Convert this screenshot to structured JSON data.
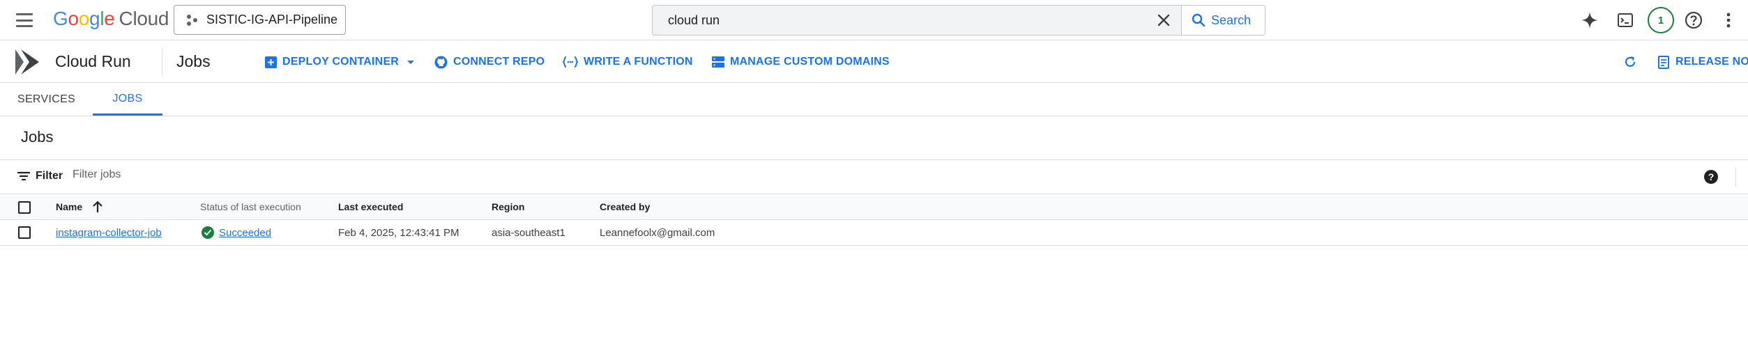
{
  "topbar": {
    "logo_google": [
      "G",
      "o",
      "o",
      "g",
      "l",
      "e"
    ],
    "logo_cloud": "Cloud",
    "project_name": "SISTIC-IG-API-Pipeline",
    "search_value": "cloud run",
    "search_button_label": "Search",
    "notification_count": "1"
  },
  "product": {
    "title": "Cloud Run",
    "page_heading": "Jobs",
    "actions": {
      "deploy_container": "DEPLOY CONTAINER",
      "connect_repo": "CONNECT REPO",
      "write_function": "WRITE A FUNCTION",
      "manage_domains": "MANAGE CUSTOM DOMAINS",
      "release_notes": "RELEASE NOTES"
    }
  },
  "tabs": [
    {
      "label": "SERVICES",
      "active": false
    },
    {
      "label": "JOBS",
      "active": true
    }
  ],
  "section": {
    "title": "Jobs",
    "filter_label": "Filter",
    "filter_placeholder": "Filter jobs",
    "help": "?"
  },
  "table": {
    "columns": [
      "Name",
      "Status of last execution",
      "Last executed",
      "Region",
      "Created by"
    ],
    "sort_column": "Name",
    "sort_direction": "ascending",
    "rows": [
      {
        "name": "instagram-collector-job",
        "status": "Succeeded",
        "last_executed": "Feb 4, 2025, 12:43:41 PM",
        "region": "asia-southeast1",
        "created_by": "Leannefoolx@gmail.com"
      }
    ]
  },
  "colors": {
    "accent": "#1a73e8",
    "success": "#188038",
    "border": "#dadce0",
    "text": "#202124"
  },
  "icons": {
    "menu": "hamburger-menu-icon",
    "project": "project-dots-icon",
    "clear": "close-icon",
    "search": "search-icon",
    "gemini": "sparkle-icon",
    "shell": "terminal-icon",
    "help": "help-icon",
    "more": "more-vert-icon",
    "refresh": "refresh-icon",
    "release_notes": "release-notes-icon",
    "status": "check-circle-icon",
    "sort": "arrow-up-icon"
  }
}
